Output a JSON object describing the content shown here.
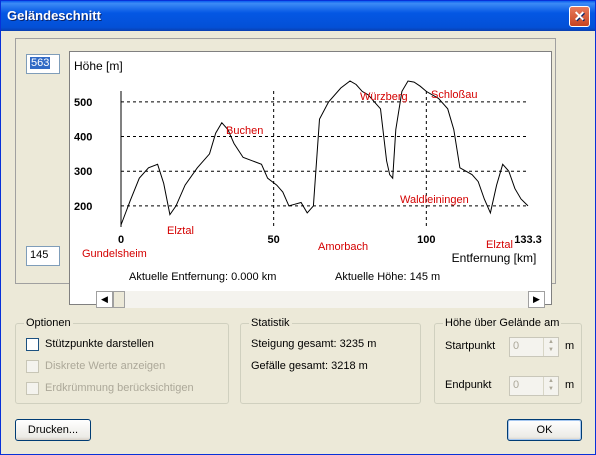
{
  "window": {
    "title": "Geländeschnitt",
    "close_symbol": "✕"
  },
  "profile": {
    "max_value": "563",
    "min_value": "145",
    "y_axis_label": "Höhe [m]",
    "x_axis_label": "Entfernung [km]",
    "y_ticks": [
      "500",
      "400",
      "300",
      "200"
    ],
    "x_ticks": [
      "0",
      "50",
      "100",
      "133.3"
    ],
    "places": [
      "Gundelsheim",
      "Elztal",
      "Buchen",
      "Amorbach",
      "Würzberg",
      "Waldleiningen",
      "Schloßau",
      "Elztal"
    ],
    "label_color": "#d40000"
  },
  "chart_data": {
    "type": "line",
    "xlabel": "Entfernung [km]",
    "ylabel": "Höhe [m]",
    "xlim": [
      0,
      133.3
    ],
    "ylim": [
      145,
      563
    ],
    "x": [
      0,
      3,
      6,
      9,
      12,
      14,
      16,
      18,
      21,
      25,
      29,
      31,
      33,
      35,
      37,
      40,
      43,
      46,
      48,
      51,
      53,
      55,
      57,
      59,
      61,
      63,
      65,
      68,
      72,
      75,
      77,
      79,
      81,
      83,
      85,
      87,
      88,
      89,
      90,
      92,
      94,
      96,
      98,
      100,
      102,
      104,
      107,
      109,
      111,
      113,
      115,
      117,
      119,
      121,
      123,
      125,
      127,
      129,
      131,
      133.3
    ],
    "values": [
      145,
      215,
      280,
      310,
      320,
      265,
      175,
      200,
      260,
      310,
      350,
      410,
      440,
      420,
      380,
      340,
      330,
      320,
      280,
      260,
      240,
      200,
      205,
      210,
      180,
      200,
      450,
      500,
      540,
      560,
      550,
      530,
      520,
      500,
      480,
      330,
      290,
      280,
      420,
      530,
      560,
      557,
      545,
      530,
      520,
      510,
      480,
      420,
      310,
      300,
      290,
      270,
      220,
      180,
      260,
      320,
      300,
      250,
      220,
      200
    ]
  },
  "status": {
    "distance": "Aktuelle Entfernung: 0.000 km",
    "height": "Aktuelle Höhe: 145 m"
  },
  "options": {
    "title": "Optionen",
    "items": [
      {
        "label": "Stützpunkte darstellen",
        "enabled": true,
        "checked": false
      },
      {
        "label": "Diskrete Werte anzeigen",
        "enabled": false,
        "checked": false
      },
      {
        "label": "Erdkrümmung berücksichtigen",
        "enabled": false,
        "checked": false
      }
    ]
  },
  "statistics": {
    "title": "Statistik",
    "ascent": "Steigung gesamt: 3235 m",
    "descent": "Gefälle gesamt: 3218 m"
  },
  "height_above": {
    "title": "Höhe über Gelände am",
    "start_label": "Startpunkt",
    "end_label": "Endpunkt",
    "start_value": "0",
    "end_value": "0",
    "unit": "m"
  },
  "buttons": {
    "print": "Drucken...",
    "ok": "OK"
  }
}
